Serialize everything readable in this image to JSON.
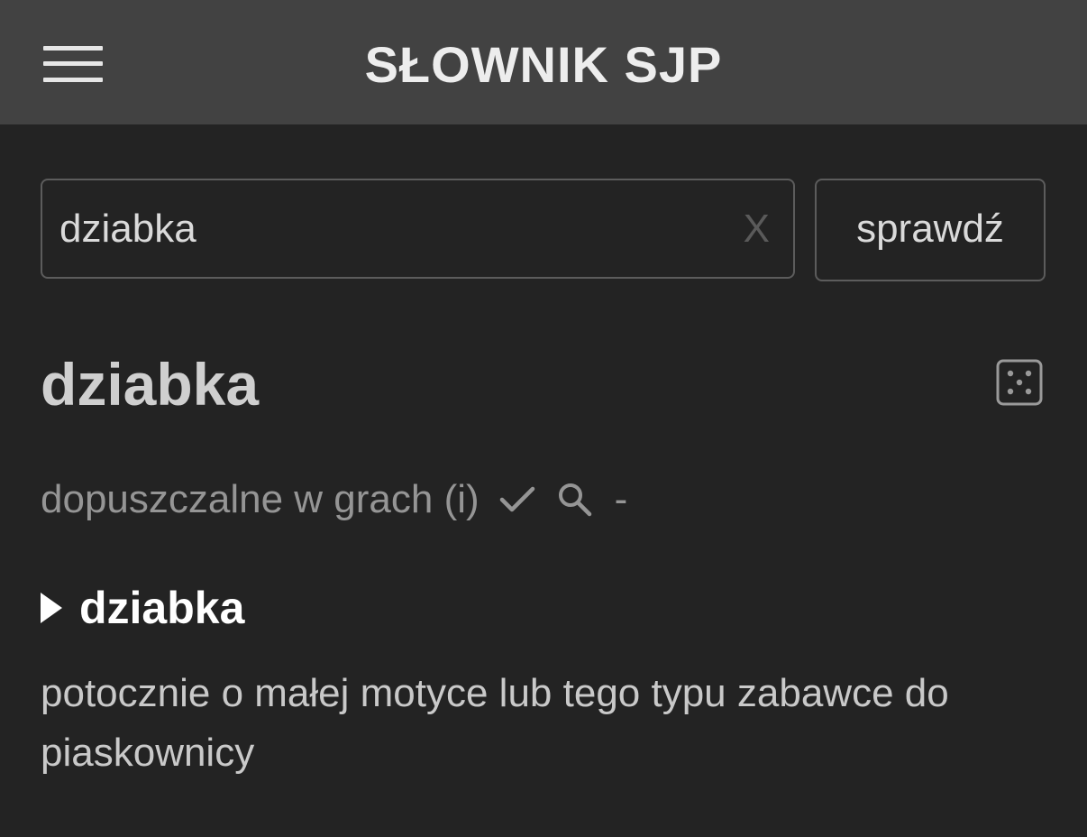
{
  "header": {
    "title": "SŁOWNIK SJP",
    "menu_icon": "hamburger-menu-icon"
  },
  "search": {
    "value": "dziabka",
    "clear_label": "X",
    "submit_label": "sprawdź"
  },
  "entry": {
    "title": "dziabka",
    "random_icon": "dice-icon",
    "status_text": "dopuszczalne w grach (i)",
    "status_check_icon": "checkmark-icon",
    "status_search_icon": "search-icon",
    "status_dash": "-",
    "definitions": [
      {
        "word": "dziabka",
        "text": "potocznie o małej motyce lub tego typu zabawce do piaskownicy"
      }
    ]
  },
  "colors": {
    "background": "#232323",
    "topbar": "#424242",
    "border": "#5c5c5c"
  }
}
